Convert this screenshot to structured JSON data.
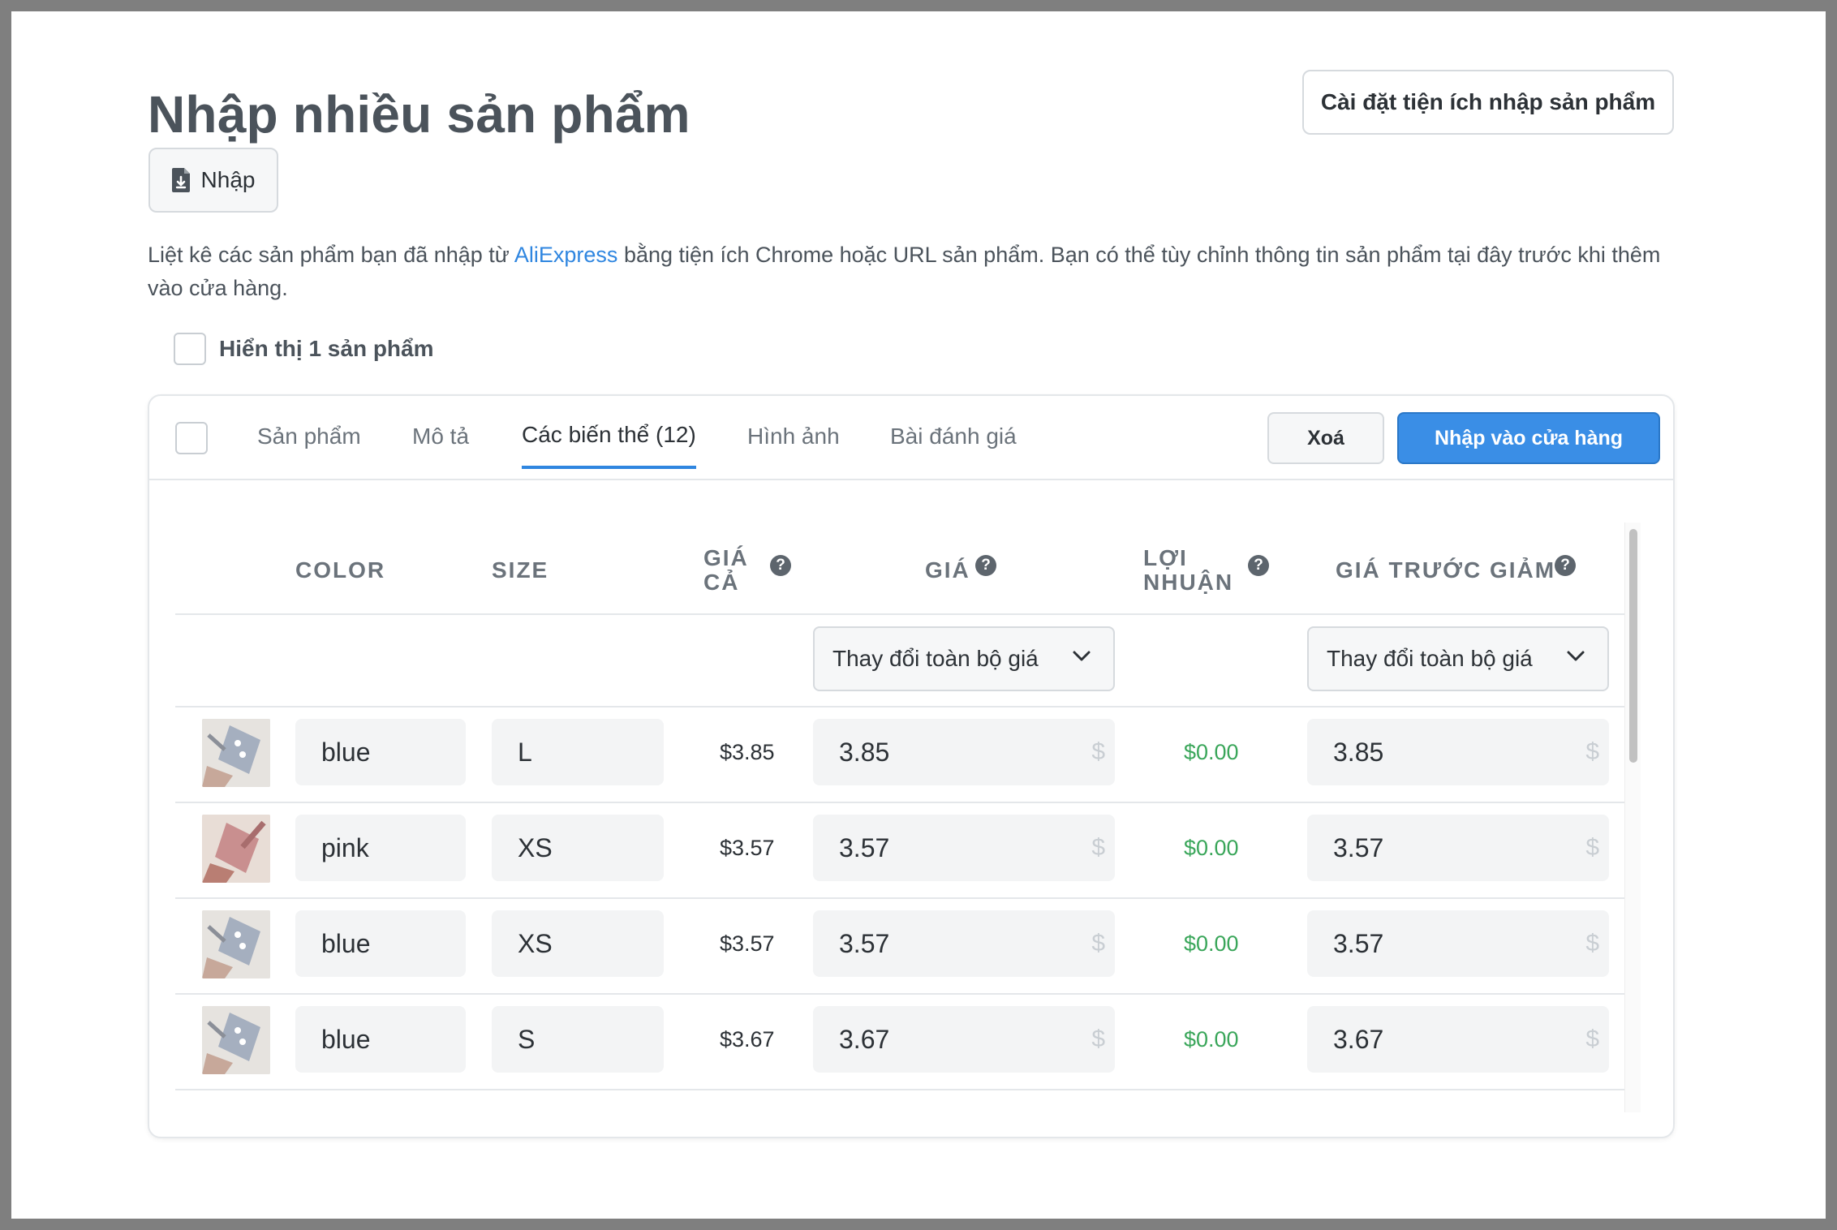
{
  "page": {
    "title": "Nhập nhiều sản phẩm",
    "settings_button": "Cài đặt tiện ích nhập sản phẩm",
    "import_button": "Nhập",
    "description": {
      "before": "Liệt kê các sản phẩm bạn đã nhập từ ",
      "link": "AliExpress",
      "after": " bằng tiện ích Chrome hoặc URL sản phẩm. Bạn có thể tùy chỉnh thông tin sản phẩm tại đây trước khi thêm vào cửa hàng."
    },
    "show_one_label": "Hiển thị 1 sản phẩm"
  },
  "card": {
    "tabs": [
      "Sản phẩm",
      "Mô tả",
      "Các biến thể (12)",
      "Hình ảnh",
      "Bài đánh giá"
    ],
    "active_tab": "Các biến thể (12)",
    "delete_button": "Xoá",
    "import_store_button": "Nhập vào cửa hàng"
  },
  "table": {
    "headers": {
      "color": "COLOR",
      "size": "SIZE",
      "cost_line1": "GIÁ",
      "cost_line2": "CẢ",
      "price": "GIÁ",
      "profit_line1": "LỢI",
      "profit_line2": "NHUẬN",
      "compare": "GIÁ TRƯỚC GIẢM"
    },
    "help_glyph": "?",
    "bulk_price_select": "Thay đổi toàn bộ giá",
    "bulk_compare_select": "Thay đổi toàn bộ giá",
    "currency_symbol": "$",
    "rows": [
      {
        "color": "blue",
        "size": "L",
        "cost": "$3.85",
        "price": "3.85",
        "profit": "$0.00",
        "compare": "3.85",
        "thumb": "blue"
      },
      {
        "color": "pink",
        "size": "XS",
        "cost": "$3.57",
        "price": "3.57",
        "profit": "$0.00",
        "compare": "3.57",
        "thumb": "pink"
      },
      {
        "color": "blue",
        "size": "XS",
        "cost": "$3.57",
        "price": "3.57",
        "profit": "$0.00",
        "compare": "3.57",
        "thumb": "blue"
      },
      {
        "color": "blue",
        "size": "S",
        "cost": "$3.67",
        "price": "3.67",
        "profit": "$0.00",
        "compare": "3.67",
        "thumb": "blue"
      }
    ]
  },
  "colors": {
    "accent": "#3a8ee6",
    "link": "#2f86e0",
    "profit": "#3aa65a"
  }
}
